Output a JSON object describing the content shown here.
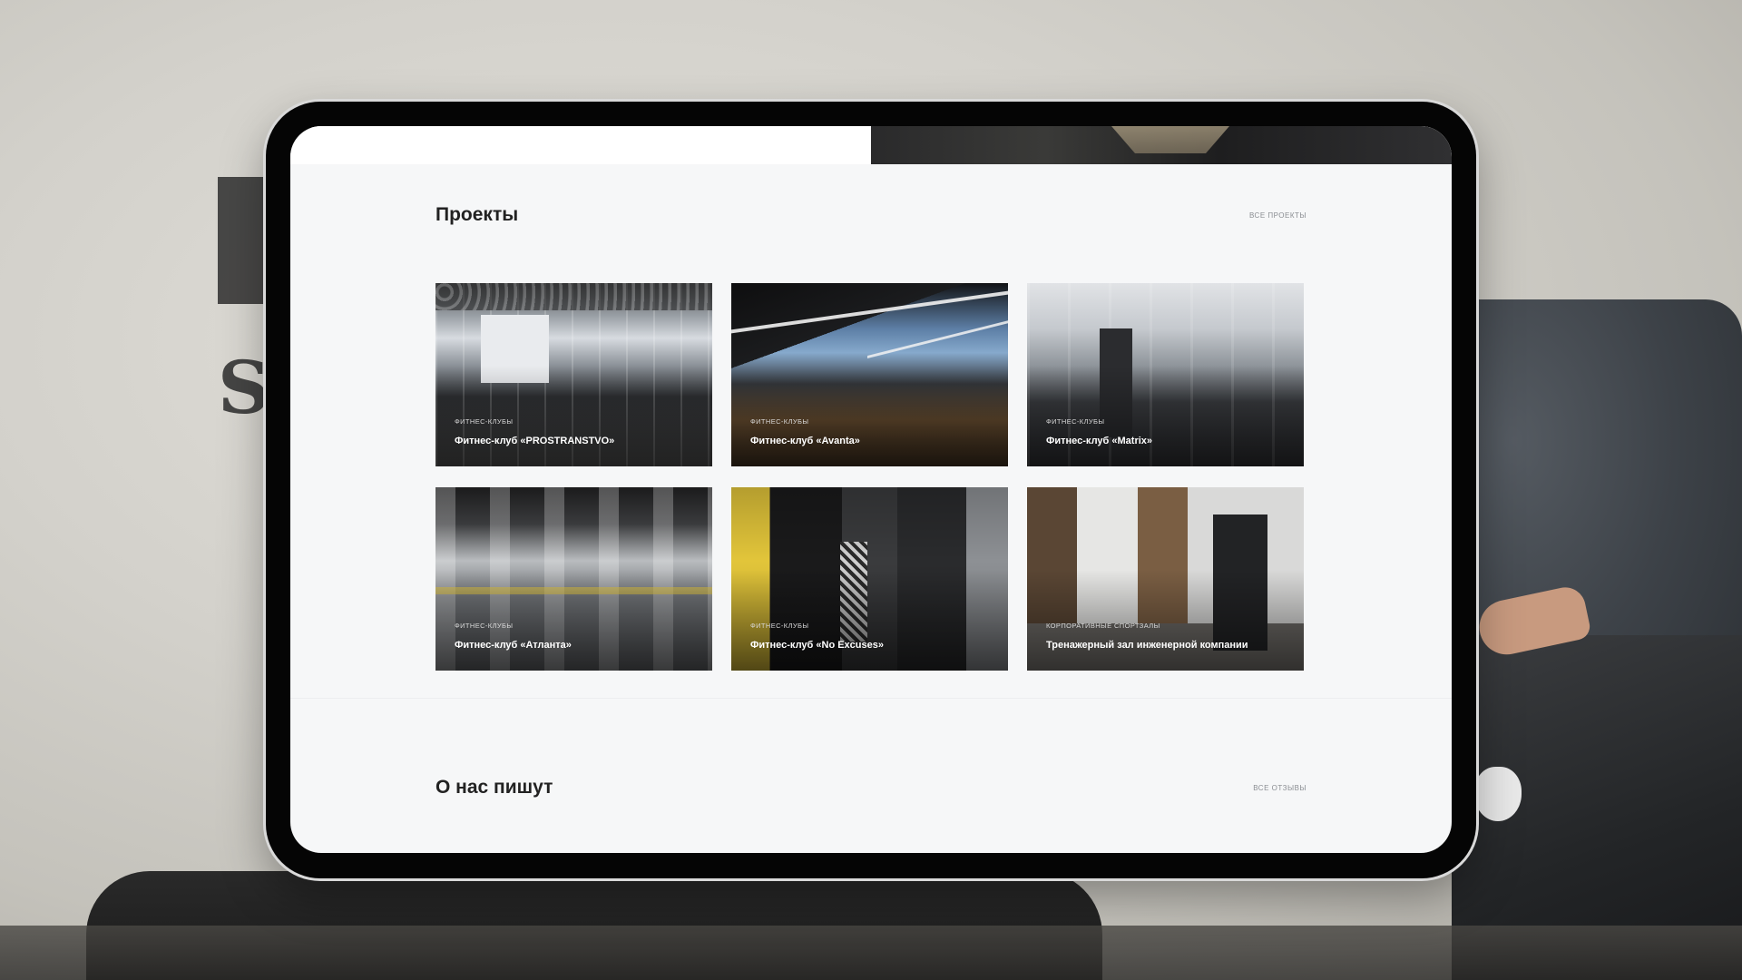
{
  "projects_section": {
    "title": "Проекты",
    "all_link": "все проекты",
    "cards": [
      {
        "category": "фитнес-клубы",
        "title": "Фитнес-клуб «PROSTRANSTVO»"
      },
      {
        "category": "фитнес-клубы",
        "title": "Фитнес-клуб «Avanta»"
      },
      {
        "category": "фитнес-клубы",
        "title": "Фитнес-клуб «Matrix»"
      },
      {
        "category": "фитнес-клубы",
        "title": "Фитнес-клуб «Атланта»"
      },
      {
        "category": "фитнес-клубы",
        "title": "Фитнес-клуб «No Excuses»"
      },
      {
        "category": "корпоративные спортзалы",
        "title": "Тренажерный зал инженерной компании"
      }
    ]
  },
  "reviews_section": {
    "title": "О нас пишут",
    "all_link": "все отзывы"
  },
  "colors": {
    "page_background": "#f6f7f8",
    "title_text": "#222222",
    "link_text": "#8a8d92",
    "card_title_text": "#ffffff",
    "device_frame": "#050505"
  }
}
